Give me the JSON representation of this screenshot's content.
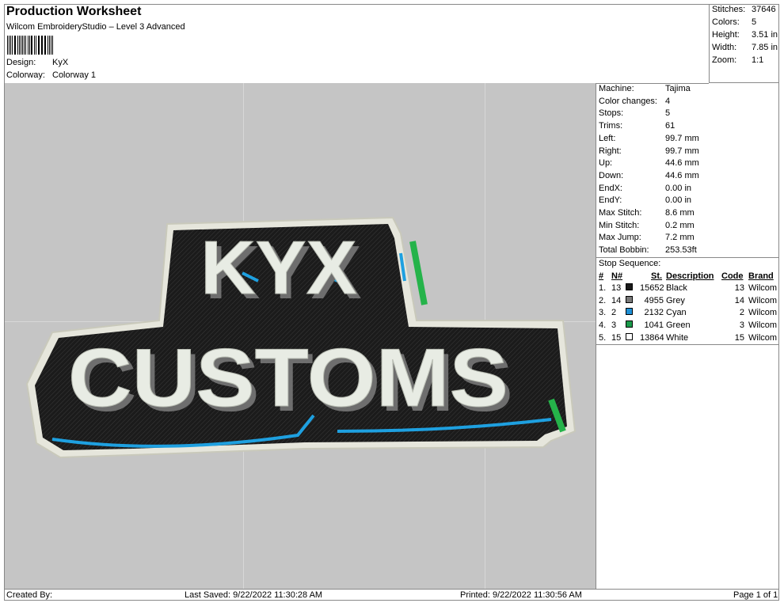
{
  "header": {
    "title": "Production Worksheet",
    "subtitle": "Wilcom EmbroideryStudio – Level 3 Advanced",
    "design_label": "Design:",
    "design_value": "KyX",
    "colorway_label": "Colorway:",
    "colorway_value": "Colorway 1"
  },
  "summary": [
    {
      "k": "Stitches:",
      "v": "37646"
    },
    {
      "k": "Colors:",
      "v": "5"
    },
    {
      "k": "Height:",
      "v": "3.51 in"
    },
    {
      "k": "Width:",
      "v": "7.85 in"
    },
    {
      "k": "Zoom:",
      "v": "1:1"
    }
  ],
  "design_text": {
    "line1": "KYX",
    "line2": "CUSTOMS"
  },
  "specs": [
    {
      "k": "Machine:",
      "v": "Tajima"
    },
    {
      "k": "Color changes:",
      "v": "4"
    },
    {
      "k": "Stops:",
      "v": "5"
    },
    {
      "k": "Trims:",
      "v": "61"
    },
    {
      "k": "Left:",
      "v": "99.7 mm"
    },
    {
      "k": "Right:",
      "v": "99.7 mm"
    },
    {
      "k": "Up:",
      "v": "44.6 mm"
    },
    {
      "k": "Down:",
      "v": "44.6 mm"
    },
    {
      "k": "EndX:",
      "v": "0.00 in"
    },
    {
      "k": "EndY:",
      "v": "0.00 in"
    },
    {
      "k": "Max Stitch:",
      "v": "8.6 mm"
    },
    {
      "k": "Min Stitch:",
      "v": "0.2 mm"
    },
    {
      "k": "Max Jump:",
      "v": "7.2 mm"
    },
    {
      "k": "Total Bobbin:",
      "v": "253.53ft"
    }
  ],
  "stop_sequence": {
    "title": "Stop Sequence:",
    "headers": {
      "num": "#",
      "n": "N#",
      "st": "St.",
      "desc": "Description",
      "code": "Code",
      "brand": "Brand"
    },
    "rows": [
      {
        "num": "1.",
        "n": "13",
        "color": "#1a1a1a",
        "st": "15652",
        "desc": "Black",
        "code": "13",
        "brand": "Wilcom"
      },
      {
        "num": "2.",
        "n": "14",
        "color": "#7a7a7a",
        "st": "4955",
        "desc": "Grey",
        "code": "14",
        "brand": "Wilcom"
      },
      {
        "num": "3.",
        "n": "2",
        "color": "#1e90d6",
        "st": "2132",
        "desc": "Cyan",
        "code": "2",
        "brand": "Wilcom"
      },
      {
        "num": "4.",
        "n": "3",
        "color": "#1a9a4a",
        "st": "1041",
        "desc": "Green",
        "code": "3",
        "brand": "Wilcom"
      },
      {
        "num": "5.",
        "n": "15",
        "color": "#ffffff",
        "st": "13864",
        "desc": "White",
        "code": "15",
        "brand": "Wilcom"
      }
    ]
  },
  "footer": {
    "created": "Created By:",
    "saved": "Last Saved: 9/22/2022 11:30:28 AM",
    "printed": "Printed: 9/22/2022 11:30:56 AM",
    "page": "Page 1 of 1"
  }
}
